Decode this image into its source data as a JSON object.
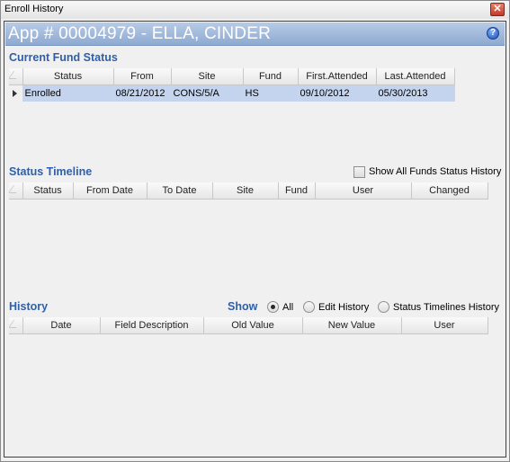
{
  "window": {
    "title": "Enroll History",
    "close_label": "✕"
  },
  "header": {
    "title": "App #  00004979 - ELLA, CINDER",
    "help_label": "?"
  },
  "current_fund_status": {
    "title": "Current Fund Status",
    "columns": [
      "Status",
      "From",
      "Site",
      "Fund",
      "First.Attended",
      "Last.Attended"
    ],
    "rows": [
      [
        "Enrolled",
        "08/21/2012",
        "CONS/5/A",
        "HS",
        "09/10/2012",
        "05/30/2013"
      ]
    ]
  },
  "status_timeline": {
    "title": "Status Timeline",
    "show_all_label": "Show All Funds Status History",
    "show_all_checked": false,
    "columns": [
      "Status",
      "From Date",
      "To Date",
      "Site",
      "Fund",
      "User",
      "Changed"
    ]
  },
  "history": {
    "title": "History",
    "show_label": "Show",
    "options": [
      "All",
      "Edit History",
      "Status Timelines History"
    ],
    "selected_option": "All",
    "columns": [
      "Date",
      "Field Description",
      "Old Value",
      "New Value",
      "User"
    ]
  },
  "colors": {
    "accent_title": "#2f5fa8",
    "header_bar": "#8ea9d1",
    "selected_row": "#c4d4ee"
  },
  "icons": [
    "close-icon",
    "help-icon",
    "row-indicator-icon"
  ]
}
